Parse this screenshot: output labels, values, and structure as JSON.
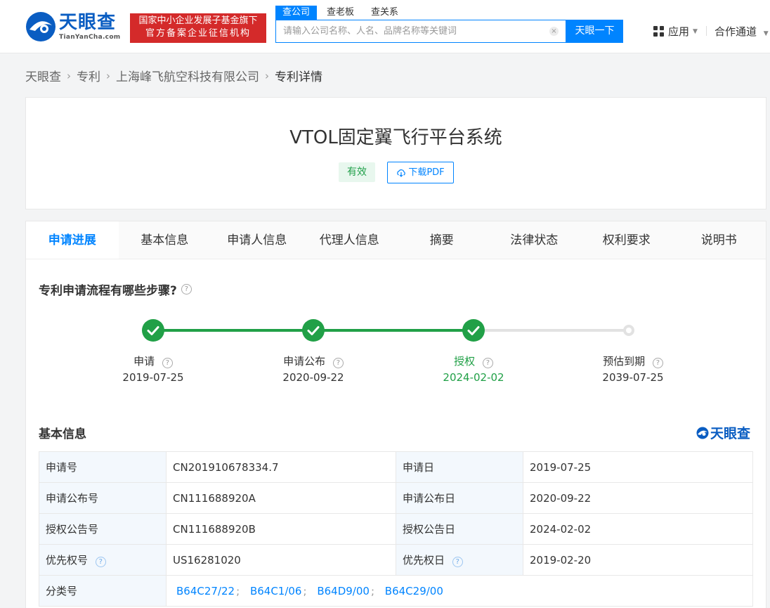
{
  "header": {
    "logo_cn": "天眼查",
    "logo_en": "TianYanCha.com",
    "slogan_line1": "国家中小企业发展子基金旗下",
    "slogan_line2": "官方备案企业征信机构",
    "search_tabs": [
      "查公司",
      "查老板",
      "查关系"
    ],
    "search_placeholder": "请输入公司名称、人名、品牌名称等关键词",
    "search_button": "天眼一下",
    "apps_label": "应用",
    "partner_label": "合作通道"
  },
  "breadcrumb": [
    "天眼查",
    "专利",
    "上海峰飞航空科技有限公司",
    "专利详情"
  ],
  "patent": {
    "title": "VTOL固定翼飞行平台系统",
    "status": "有效",
    "download_label": "下载PDF"
  },
  "tabs": [
    "申请进展",
    "基本信息",
    "申请人信息",
    "代理人信息",
    "摘要",
    "法律状态",
    "权利要求",
    "说明书"
  ],
  "progress_section": {
    "title": "专利申请流程有哪些步骤?",
    "steps": [
      {
        "label": "申请",
        "date": "2019-07-25"
      },
      {
        "label": "申请公布",
        "date": "2020-09-22"
      },
      {
        "label": "授权",
        "date": "2024-02-02"
      },
      {
        "label": "预估到期",
        "date": "2039-07-25"
      }
    ]
  },
  "basic_section": {
    "title": "基本信息",
    "brand": "天眼查",
    "rows": [
      {
        "k1": "申请号",
        "v1": "CN201910678334.7",
        "k2": "申请日",
        "v2": "2019-07-25"
      },
      {
        "k1": "申请公布号",
        "v1": "CN111688920A",
        "k2": "申请公布日",
        "v2": "2020-09-22"
      },
      {
        "k1": "授权公告号",
        "v1": "CN111688920B",
        "k2": "授权公告日",
        "v2": "2024-02-02"
      },
      {
        "k1": "优先权号",
        "v1": "US16281020",
        "k2": "优先权日",
        "v2": "2019-02-20"
      }
    ],
    "class_label": "分类号",
    "classes": [
      "B64C27/22",
      "B64C1/06",
      "B64D9/00",
      "B64C29/00"
    ],
    "class_separator": ";"
  },
  "colors": {
    "brand_blue": "#0084ff",
    "logo_blue": "#0a5dc2",
    "success_green": "#21a047",
    "slogan_red": "#d42a2a"
  }
}
